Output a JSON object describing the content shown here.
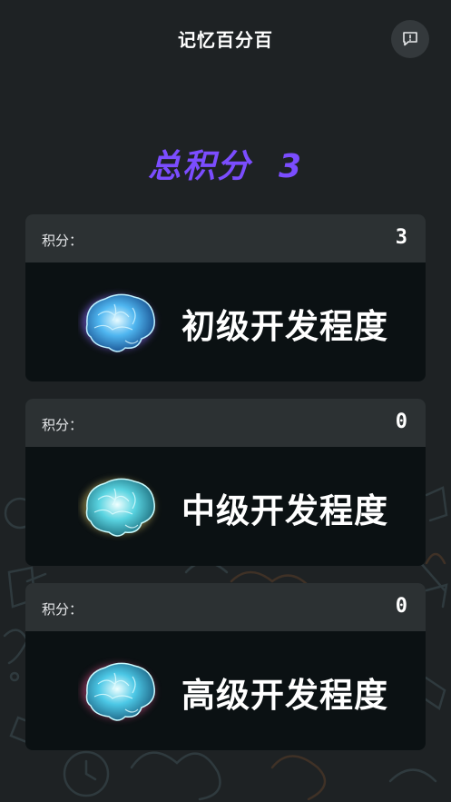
{
  "header": {
    "title": "记忆百分百",
    "feedback_icon": "feedback-message-icon"
  },
  "total": {
    "label": "总积分",
    "value": "3"
  },
  "levels": [
    {
      "score_label": "积分：",
      "score": "3",
      "title": "初级开发程度",
      "icon": "brain-icon",
      "glow": "#8a6bff"
    },
    {
      "score_label": "积分：",
      "score": "0",
      "title": "中级开发程度",
      "icon": "brain-icon",
      "glow": "#d9c66a"
    },
    {
      "score_label": "积分：",
      "score": "0",
      "title": "高级开发程度",
      "icon": "brain-icon",
      "glow": "#e0508c"
    }
  ],
  "colors": {
    "background": "#1e2224",
    "accent": "#7b4dff",
    "card_header": "#2c3133",
    "card_body": "#0b1113"
  }
}
